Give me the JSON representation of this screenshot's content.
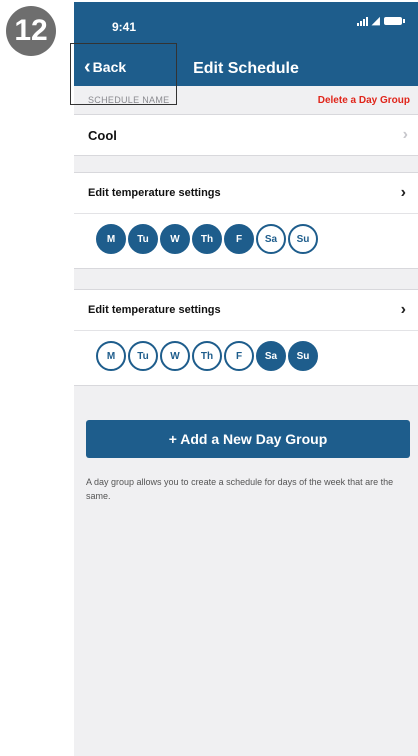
{
  "step": {
    "number": "12"
  },
  "status_bar": {
    "time": "9:41"
  },
  "nav": {
    "back_label": "Back",
    "title": "Edit Schedule"
  },
  "schedule": {
    "section_label": "SCHEDULE NAME",
    "delete_label": "Delete a Day Group",
    "name": "Cool"
  },
  "day_groups": [
    {
      "label": "Edit temperature settings",
      "days": [
        {
          "label": "M",
          "selected": true
        },
        {
          "label": "Tu",
          "selected": true
        },
        {
          "label": "W",
          "selected": true
        },
        {
          "label": "Th",
          "selected": true
        },
        {
          "label": "F",
          "selected": true
        },
        {
          "label": "Sa",
          "selected": false
        },
        {
          "label": "Su",
          "selected": false
        }
      ]
    },
    {
      "label": "Edit temperature settings",
      "days": [
        {
          "label": "M",
          "selected": false
        },
        {
          "label": "Tu",
          "selected": false
        },
        {
          "label": "W",
          "selected": false
        },
        {
          "label": "Th",
          "selected": false
        },
        {
          "label": "F",
          "selected": false
        },
        {
          "label": "Sa",
          "selected": true
        },
        {
          "label": "Su",
          "selected": true
        }
      ]
    }
  ],
  "add_button": {
    "label": "+ Add a New Day Group"
  },
  "help_text": "A day group allows you to create a schedule for days of the week that are the same.",
  "colors": {
    "primary": "#1e5d8c",
    "danger": "#e0251a",
    "background": "#f0f0f2"
  },
  "icons": {
    "back": "chevron-left-icon",
    "row": "chevron-right-icon"
  }
}
